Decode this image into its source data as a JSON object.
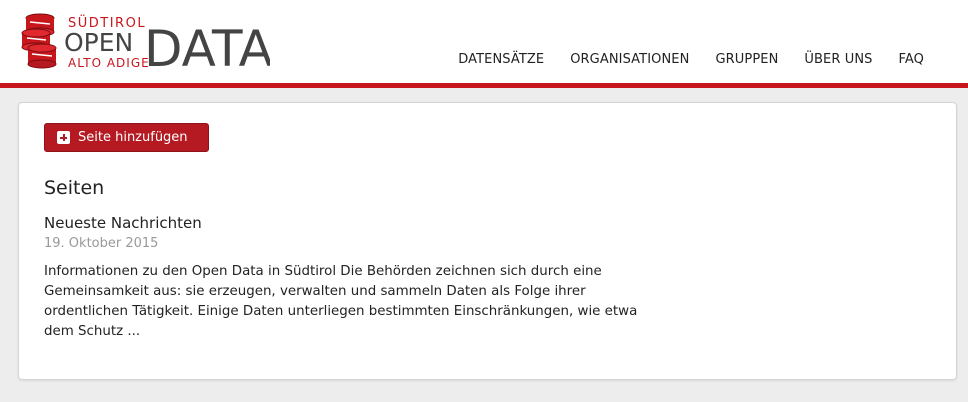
{
  "logo": {
    "top_line": "SÜDTIROL",
    "middle_line": "OPEN",
    "bottom_line": "ALTO ADIGE",
    "big_word": "DATA"
  },
  "nav": {
    "items": [
      "DATENSÄTZE",
      "ORGANISATIONEN",
      "GRUPPEN",
      "ÜBER UNS",
      "FAQ"
    ]
  },
  "colors": {
    "accent": "#c8161d",
    "button": "#b51a22",
    "background": "#ededed"
  },
  "panel": {
    "add_button_label": "Seite hinzufügen",
    "add_button_icon": "plus-square-icon",
    "section_title": "Seiten",
    "items": [
      {
        "title": "Neueste Nachrichten",
        "date": "19. Oktober 2015",
        "text": "Informationen zu den Open Data in Südtirol Die Behörden zeichnen sich durch eine Gemeinsamkeit aus: sie erzeugen, verwalten und sammeln Daten als Folge ihrer ordentlichen Tätigkeit. Einige Daten unterliegen bestimmten Einschränkungen, wie etwa dem Schutz ..."
      }
    ]
  }
}
